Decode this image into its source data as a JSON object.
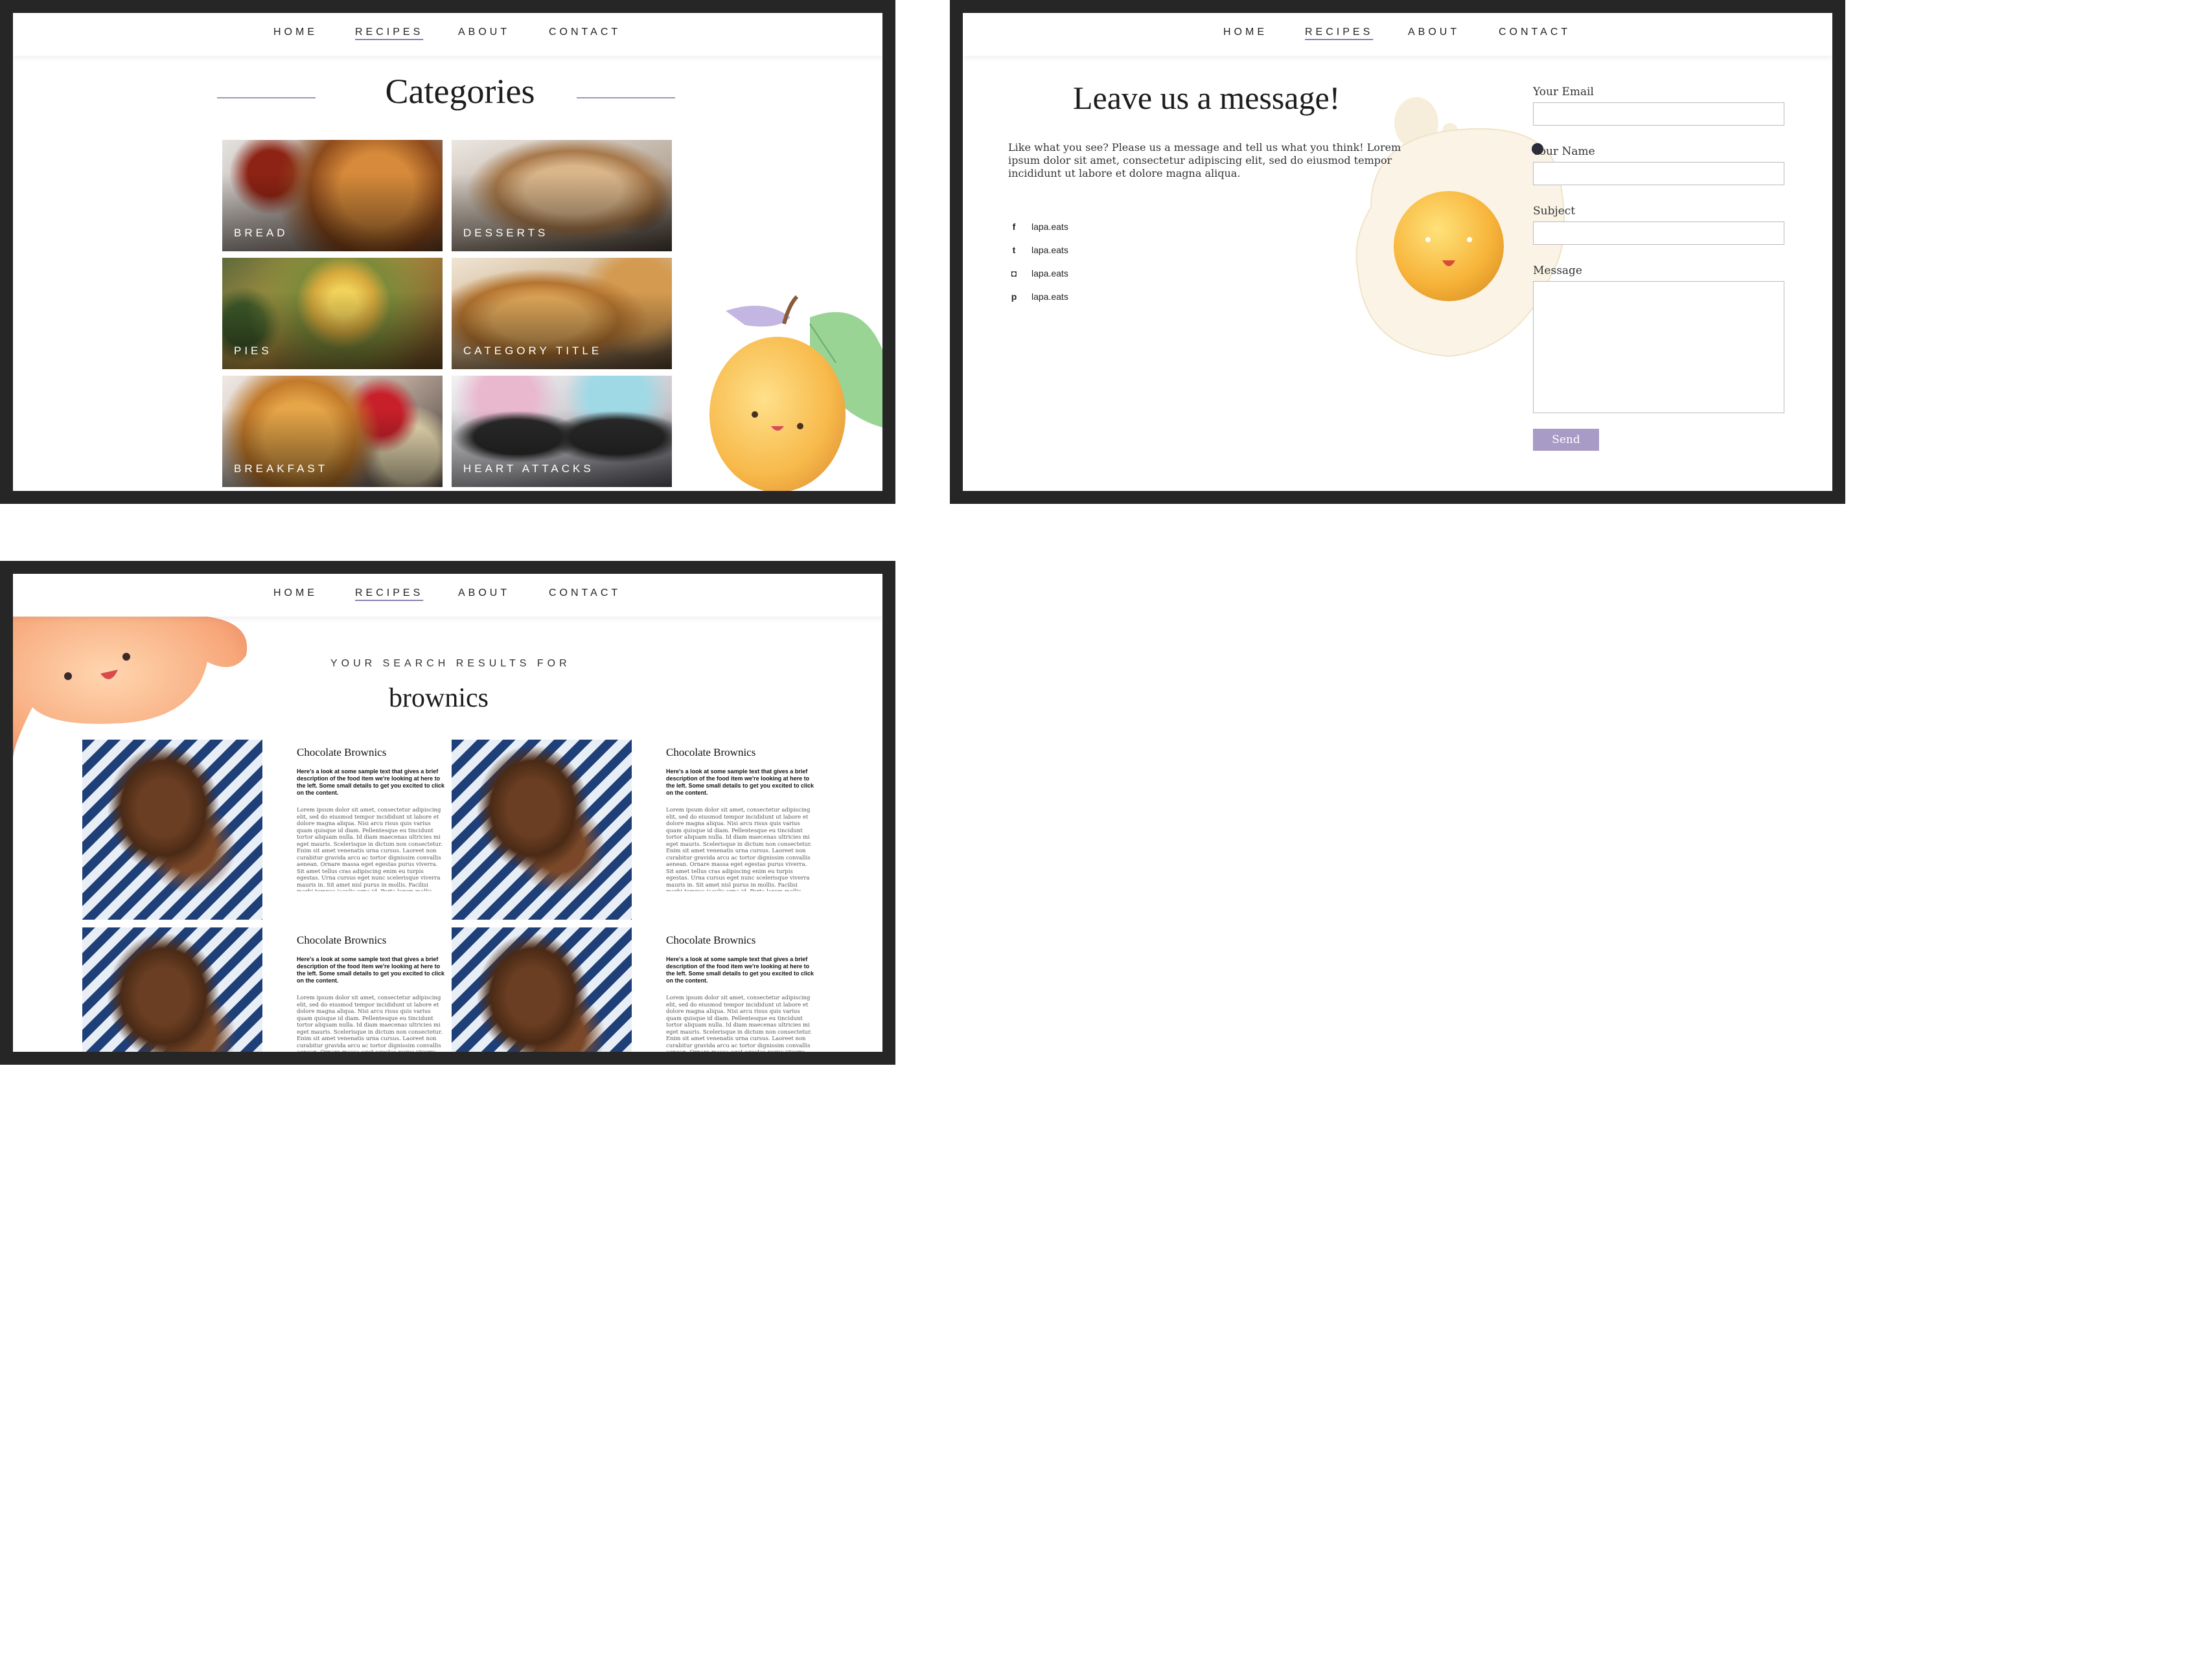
{
  "nav": {
    "home": "HOME",
    "recipes": "RECIPES",
    "about": "ABOUT",
    "contact": "CONTACT"
  },
  "categories": {
    "title": "Categories",
    "tiles": [
      {
        "label": "BREAD"
      },
      {
        "label": "DESSERTS"
      },
      {
        "label": "PIES"
      },
      {
        "label": "CATEGORY TITLE"
      },
      {
        "label": "BREAKFAST"
      },
      {
        "label": "HEART ATTACKS"
      }
    ]
  },
  "contact": {
    "title": "Leave us a message!",
    "intro": "Like what you see? Please us a message and tell us what you think! Lorem ipsum dolor sit amet, consectetur adipiscing elit, sed do eiusmod tempor incididunt ut labore et dolore magna aliqua.",
    "socials": [
      {
        "icon": "facebook-icon",
        "glyph": "f",
        "handle": "lapa.eats"
      },
      {
        "icon": "twitter-icon",
        "glyph": "t",
        "handle": "lapa.eats"
      },
      {
        "icon": "instagram-icon",
        "glyph": "◘",
        "handle": "lapa.eats"
      },
      {
        "icon": "pinterest-icon",
        "glyph": "p",
        "handle": "lapa.eats"
      }
    ],
    "form": {
      "email_label": "Your Email",
      "name_label": "Your Name",
      "subject_label": "Subject",
      "message_label": "Message",
      "send_label": "Send"
    }
  },
  "search": {
    "kicker": "YOUR SEARCH RESULTS FOR",
    "term": "brownics",
    "results": [
      {
        "title": "Chocolate Brownics",
        "desc": "Here's a look at some sample text that gives a brief description of the food item we're looking at here to the left. Some small details to get you excited to click on the content.",
        "body": "Lorem ipsum dolor sit amet, consectetur adipiscing elit, sed do eiusmod tempor incididunt ut labore et dolore magna aliqua. Nisi arcu risus quis varius quam quisque id diam. Pellentesque eu tincidunt tortor aliquam nulla. Id diam maecenas ultricies mi eget mauris. Scelerisque in dictum non consectetur. Enim sit amet venenatis urna cursus. Laoreet non curabitur gravida arcu ac tortor dignissim convallis aenean. Ornare massa eget egestas purus viverra. Sit amet tellus cras adipiscing enim eu turpis egestas. Urna cursus eget nunc scelerisque viverra mauris in. Sit amet nisl purus in mollis. Facilisi morbi tempus iaculis urna id. Porta lorem mollis aliquam ut."
      },
      {
        "title": "Chocolate Brownics",
        "desc": "Here's a look at some sample text that gives a brief description of the food item we're looking at here to the left. Some small details to get you excited to click on the content.",
        "body": "Lorem ipsum dolor sit amet, consectetur adipiscing elit, sed do eiusmod tempor incididunt ut labore et dolore magna aliqua. Nisi arcu risus quis varius quam quisque id diam. Pellentesque eu tincidunt tortor aliquam nulla. Id diam maecenas ultricies mi eget mauris. Scelerisque in dictum non consectetur. Enim sit amet venenatis urna cursus. Laoreet non curabitur gravida arcu ac tortor dignissim convallis aenean. Ornare massa eget egestas purus viverra. Sit amet tellus cras adipiscing enim eu turpis egestas. Urna cursus eget nunc scelerisque viverra mauris in. Sit amet nisl purus in mollis. Facilisi morbi tempus iaculis urna id. Porta lorem mollis aliquam ut."
      },
      {
        "title": "Chocolate Brownics",
        "desc": "Here's a look at some sample text that gives a brief description of the food item we're looking at here to the left. Some small details to get you excited to click on the content.",
        "body": "Lorem ipsum dolor sit amet, consectetur adipiscing elit, sed do eiusmod tempor incididunt ut labore et dolore magna aliqua. Nisi arcu risus quis varius quam quisque id diam. Pellentesque eu tincidunt tortor aliquam nulla. Id diam maecenas ultricies mi eget mauris. Scelerisque in dictum non consectetur. Enim sit amet venenatis urna cursus. Laoreet non curabitur gravida arcu ac tortor dignissim convallis aenean. Ornare massa eget egestas purus viverra. Sit amet tellus cras adipiscing enim eu turpis egestas. Urna cursus eget nunc scelerisque viverra mauris in."
      },
      {
        "title": "Chocolate Brownics",
        "desc": "Here's a look at some sample text that gives a brief description of the food item we're looking at here to the left. Some small details to get you excited to click on the content.",
        "body": "Lorem ipsum dolor sit amet, consectetur adipiscing elit, sed do eiusmod tempor incididunt ut labore et dolore magna aliqua. Nisi arcu risus quis varius quam quisque id diam. Pellentesque eu tincidunt tortor aliquam nulla. Id diam maecenas ultricies mi eget mauris. Scelerisque in dictum non consectetur. Enim sit amet venenatis urna cursus. Laoreet non curabitur gravida arcu ac tortor dignissim convallis aenean. Ornare massa eget egestas purus viverra. Sit amet tellus cras adipiscing enim eu turpis egestas. Urna cursus eget nunc scelerisque viverra mauris in."
      }
    ]
  },
  "colors": {
    "accent": "#a89bc6",
    "frame": "#262626",
    "divider": "#9a97b8"
  }
}
